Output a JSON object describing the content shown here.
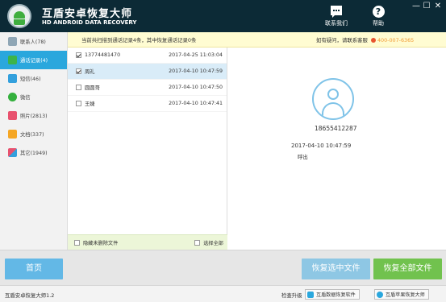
{
  "app": {
    "title": "互盾安卓恢复大师",
    "subtitle": "HD ANDROID DATA RECOVERY",
    "contact_label": "联系我们",
    "help_label": "帮助",
    "minimize": "—",
    "maximize": "☐",
    "close": "✕"
  },
  "sidebar": {
    "items": [
      {
        "label": "联系人(78)",
        "icon": "contacts-icon",
        "color": "#8fa6b5"
      },
      {
        "label": "通话记录(4)",
        "icon": "phone-icon",
        "color": "#3cb44a"
      },
      {
        "label": "短信(46)",
        "icon": "sms-icon",
        "color": "#33a0dd"
      },
      {
        "label": "微信",
        "icon": "wechat-icon",
        "color": "#34b03d"
      },
      {
        "label": "照片(2813)",
        "icon": "photo-icon",
        "color": "#e8516e"
      },
      {
        "label": "文档(337)",
        "icon": "document-icon",
        "color": "#f5a623"
      },
      {
        "label": "其它(1949)",
        "icon": "other-icon",
        "color": "#8e6fd0"
      }
    ],
    "active_index": 1
  },
  "banner": {
    "message": "当前共扫描到通话记录4条，其中恢复通话记录0条",
    "service_prefix": "如有疑问，请联系客服",
    "service_phone": "400-007-6365"
  },
  "call_list": {
    "rows": [
      {
        "name": "13774481470",
        "time": "2017-04-25 11:03:04",
        "checked": true,
        "selected": false
      },
      {
        "name": "周礼",
        "time": "2017-04-10 10:47:59",
        "checked": true,
        "selected": true
      },
      {
        "name": "圆圆哥",
        "time": "2017-04-10 10:47:50",
        "checked": false,
        "selected": false
      },
      {
        "name": "王婕",
        "time": "2017-04-10 10:47:41",
        "checked": false,
        "selected": false
      }
    ],
    "hide_deleted_label": "隐藏未删除文件",
    "select_all_label": "选择全部"
  },
  "detail": {
    "phone": "18655412287",
    "time": "2017-04-10 10:47:59",
    "type": "呼出"
  },
  "buttons": {
    "home": "首页",
    "recover_selected": "恢复选中文件",
    "recover_all": "恢复全部文件"
  },
  "status": {
    "version": "互盾安卓恢复大师1.2",
    "upgrade": "检查升级",
    "link1": "互盾数据恢复软件",
    "link2": "互盾苹果恢复大师"
  },
  "colors": {
    "title_bg": "#0c2a36",
    "accent": "#2aa7dd",
    "green": "#71c24e",
    "banner_bg": "#fffcd2"
  }
}
